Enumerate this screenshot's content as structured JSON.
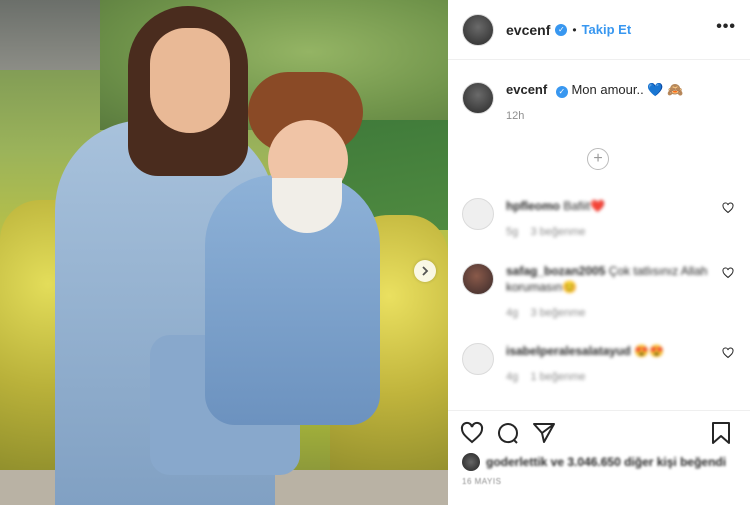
{
  "post": {
    "username": "evcenf",
    "follow_label": "Takip Et",
    "more_label": "•••",
    "separator": "•"
  },
  "caption": {
    "username": "evcenf",
    "text": "Mon amour..",
    "emojis": "💙 🙈",
    "timestamp": "12h"
  },
  "comments": [
    {
      "username": "hpfleomo",
      "text": "Bafiit❤️",
      "age": "5g",
      "likes": "3 beğenme"
    },
    {
      "username": "safag_bozan2005",
      "text": "Çok tatlısınız Allah korumasın😊",
      "age": "4g",
      "likes": "3 beğenme"
    },
    {
      "username": "isabelperalesalatayud",
      "text": "😍😍",
      "age": "4g",
      "likes": "1 beğenme"
    }
  ],
  "likes": {
    "text": "goderlettik ve 3.046.650 diğer kişi beğendi"
  },
  "date": "16 MAYIS",
  "icons": {
    "verified": "verified-badge",
    "next": "chevron-right",
    "load_more": "plus-circle",
    "heart": "heart-outline",
    "comment": "speech-bubble",
    "share": "paper-plane",
    "save": "bookmark"
  },
  "colors": {
    "accent": "#3897f0",
    "muted": "#8e8e8e"
  }
}
